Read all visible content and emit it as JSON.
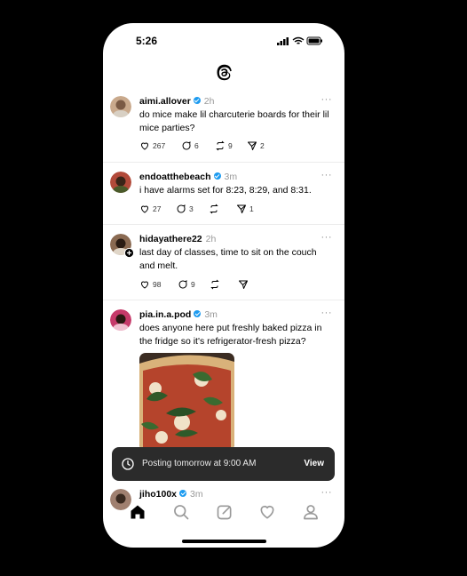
{
  "status_bar": {
    "time": "5:26"
  },
  "app": {
    "logo_icon": "threads-logo-icon"
  },
  "posts": [
    {
      "username": "aimi.allover",
      "verified": true,
      "time": "2h",
      "text": "do mice make lil charcuterie boards for their lil mice parties?",
      "likes": "267",
      "replies": "6",
      "reposts": "9",
      "shares": "2"
    },
    {
      "username": "endoatthebeach",
      "verified": true,
      "time": "3m",
      "text": "i have alarms set for 8:23, 8:29, and 8:31.",
      "likes": "27",
      "replies": "3",
      "reposts": "",
      "shares": "1"
    },
    {
      "username": "hidayathere22",
      "verified": false,
      "time": "2h",
      "text": "last day of classes, time to sit on the couch and melt.",
      "likes": "98",
      "replies": "9",
      "reposts": "",
      "shares": ""
    },
    {
      "username": "pia.in.a.pod",
      "verified": true,
      "time": "3m",
      "text": "does anyone here put freshly baked pizza in the fridge so it's refrigerator-fresh pizza?",
      "likes": "",
      "replies": "",
      "reposts": "",
      "shares": ""
    },
    {
      "username": "jiho100x",
      "verified": true,
      "time": "3m"
    }
  ],
  "more_glyph": "···",
  "toast": {
    "message": "Posting tomorrow at 9:00 AM",
    "action": "View"
  },
  "bottom_nav": [
    "home-icon",
    "search-icon",
    "compose-icon",
    "heart-icon",
    "profile-icon"
  ],
  "colors": {
    "verified": "#1d9bf0",
    "toast_bg": "#2b2b2b"
  }
}
